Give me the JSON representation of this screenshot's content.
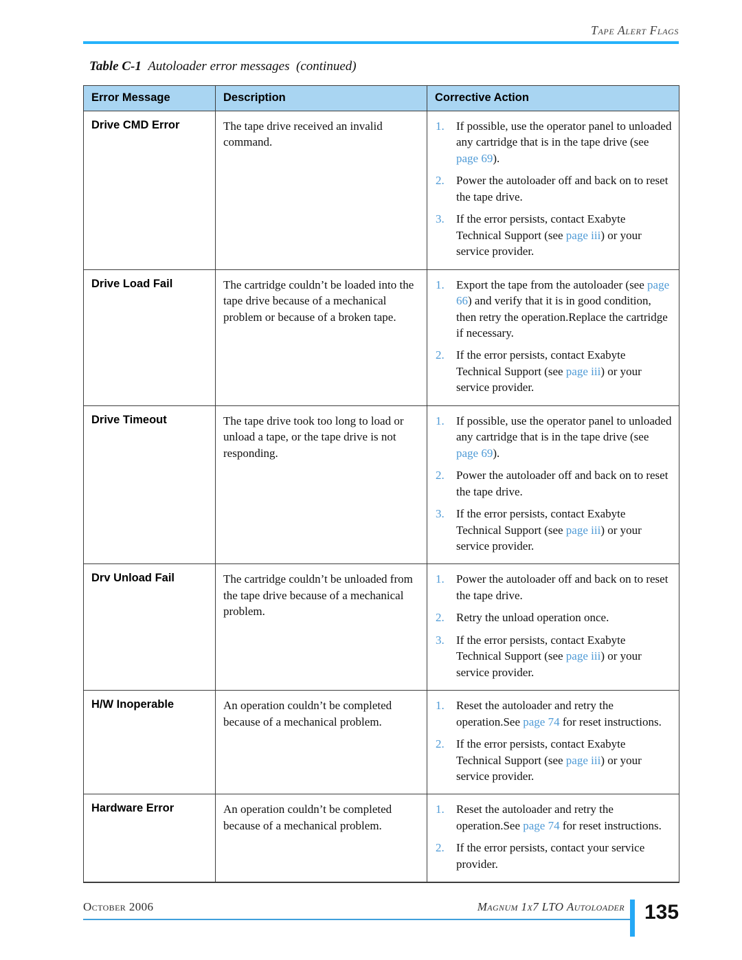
{
  "header": {
    "running_head": "Tape Alert Flags",
    "rule_color": "#25b2fb"
  },
  "caption": {
    "number": "Table C-1",
    "text": "Autoloader error messages",
    "continued": "(continued)"
  },
  "table": {
    "header_bg": "#a9d5f2",
    "link_color": "#4e9ad6",
    "columns": [
      "Error Message",
      "Description",
      "Corrective Action"
    ],
    "rows": [
      {
        "error": "Drive CMD Error",
        "description": "The tape drive received an invalid command.",
        "actions": [
          {
            "num": "1.",
            "parts": [
              {
                "t": "If possible, use the operator panel to unloaded any cartridge that is in the tape drive (see "
              },
              {
                "t": "page 69",
                "link": true
              },
              {
                "t": ")."
              }
            ]
          },
          {
            "num": "2.",
            "parts": [
              {
                "t": "Power the autoloader off and back on to reset the tape drive."
              }
            ]
          },
          {
            "num": "3.",
            "parts": [
              {
                "t": "If the error persists, contact Exabyte Technical Support (see "
              },
              {
                "t": "page iii",
                "link": true
              },
              {
                "t": ") or your service provider."
              }
            ]
          }
        ]
      },
      {
        "error": "Drive Load Fail",
        "description": "The cartridge couldn’t be loaded into the tape drive because of a mechanical problem or because of a broken tape.",
        "actions": [
          {
            "num": "1.",
            "parts": [
              {
                "t": "Export the tape from the autoloader (see "
              },
              {
                "t": "page 66",
                "link": true
              },
              {
                "t": ") and verify that it is in good condition, then retry the operation.Replace the cartridge if necessary."
              }
            ]
          },
          {
            "num": "2.",
            "parts": [
              {
                "t": "If the error persists, contact Exabyte Technical Support (see "
              },
              {
                "t": "page iii",
                "link": true
              },
              {
                "t": ") or your service provider."
              }
            ]
          }
        ]
      },
      {
        "error": "Drive Timeout",
        "description": "The tape drive took too long to load or unload a tape, or the tape drive is not responding.",
        "actions": [
          {
            "num": "1.",
            "parts": [
              {
                "t": "If possible, use the operator panel to unloaded any cartridge that is in the tape drive (see "
              },
              {
                "t": "page 69",
                "link": true
              },
              {
                "t": ")."
              }
            ]
          },
          {
            "num": "2.",
            "parts": [
              {
                "t": "Power the autoloader off and back on to reset the tape drive."
              }
            ]
          },
          {
            "num": "3.",
            "parts": [
              {
                "t": "If the error persists, contact Exabyte Technical Support (see "
              },
              {
                "t": "page iii",
                "link": true
              },
              {
                "t": ") or your service provider."
              }
            ]
          }
        ]
      },
      {
        "error": "Drv Unload Fail",
        "description": "The cartridge couldn’t be unloaded from the tape drive because of a mechanical problem.",
        "actions": [
          {
            "num": "1.",
            "parts": [
              {
                "t": "Power the autoloader off and back on to reset the tape drive."
              }
            ]
          },
          {
            "num": "2.",
            "parts": [
              {
                "t": "Retry the unload operation once."
              }
            ]
          },
          {
            "num": "3.",
            "parts": [
              {
                "t": "If the error persists, contact Exabyte Technical Support (see "
              },
              {
                "t": "page iii",
                "link": true
              },
              {
                "t": ") or your service provider."
              }
            ]
          }
        ]
      },
      {
        "error": "H/W Inoperable",
        "description": "An operation couldn’t be completed because of a mechanical problem.",
        "actions": [
          {
            "num": "1.",
            "parts": [
              {
                "t": "Reset the autoloader and retry the operation.See "
              },
              {
                "t": "page 74",
                "link": true
              },
              {
                "t": " for reset instructions."
              }
            ]
          },
          {
            "num": "2.",
            "parts": [
              {
                "t": "If the error persists, contact Exabyte Technical Support (see "
              },
              {
                "t": "page iii",
                "link": true
              },
              {
                "t": ") or your service provider."
              }
            ]
          }
        ]
      },
      {
        "error": "Hardware Error",
        "description": "An operation couldn’t be completed because of a mechanical problem.",
        "actions": [
          {
            "num": "1.",
            "parts": [
              {
                "t": "Reset the autoloader and retry the operation.See "
              },
              {
                "t": "page 74",
                "link": true
              },
              {
                "t": " for reset instructions."
              }
            ]
          },
          {
            "num": "2.",
            "parts": [
              {
                "t": "If the error persists, contact your service provider."
              }
            ]
          }
        ]
      }
    ]
  },
  "footer": {
    "date": "October 2006",
    "product": "Magnum 1x7 LTO Autoloader",
    "page_number": "135",
    "bar_color": "#25a8f5"
  }
}
